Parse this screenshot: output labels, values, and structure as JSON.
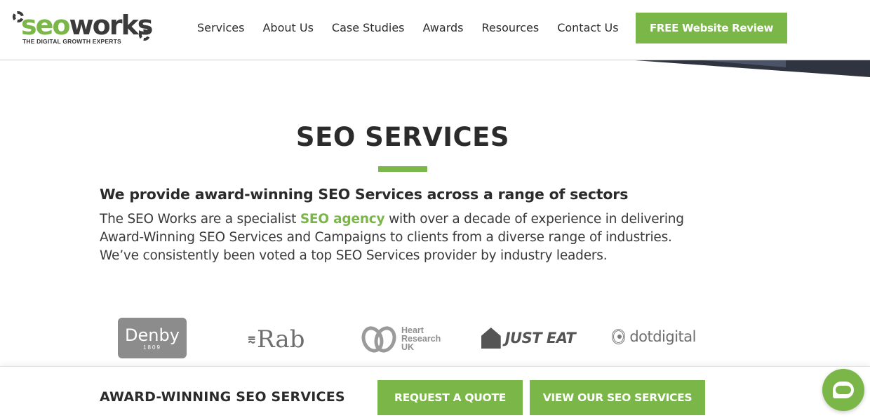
{
  "header": {
    "logo": {
      "seo": "seo",
      "works": "works",
      "tagline": "THE DIGITAL GROWTH EXPERTS"
    },
    "nav": [
      {
        "label": "Services"
      },
      {
        "label": "About Us"
      },
      {
        "label": "Case Studies"
      },
      {
        "label": "Awards"
      },
      {
        "label": "Resources"
      },
      {
        "label": "Contact Us"
      }
    ],
    "cta_label": "FREE Website Review"
  },
  "main": {
    "title": "SEO SERVICES",
    "subtitle": "We provide award-winning SEO Services across a range of sectors",
    "para_before": "The SEO Works are a specialist ",
    "para_link": "SEO agency",
    "para_after": " with over a decade of experience in delivering Award-Winning SEO Services and Campaigns to clients from a diverse range of industries. We’ve consistently been voted a top SEO Services provider by industry leaders."
  },
  "clients": {
    "denby": {
      "name": "Denby",
      "year": "1809"
    },
    "rab": {
      "name": "Rab"
    },
    "heart": {
      "line1": "Heart",
      "line2": "Research",
      "line3": "UK"
    },
    "justeat": {
      "name": "JUST EAT"
    },
    "dotdigital": {
      "name": "dotdigital"
    }
  },
  "bottom_bar": {
    "label": "AWARD-WINNING SEO SERVICES",
    "quote_label": "REQUEST A QUOTE",
    "services_label": "VIEW OUR SEO SERVICES"
  },
  "colors": {
    "brand_green": "#7ab648",
    "text_dark": "#2b2b2b"
  }
}
